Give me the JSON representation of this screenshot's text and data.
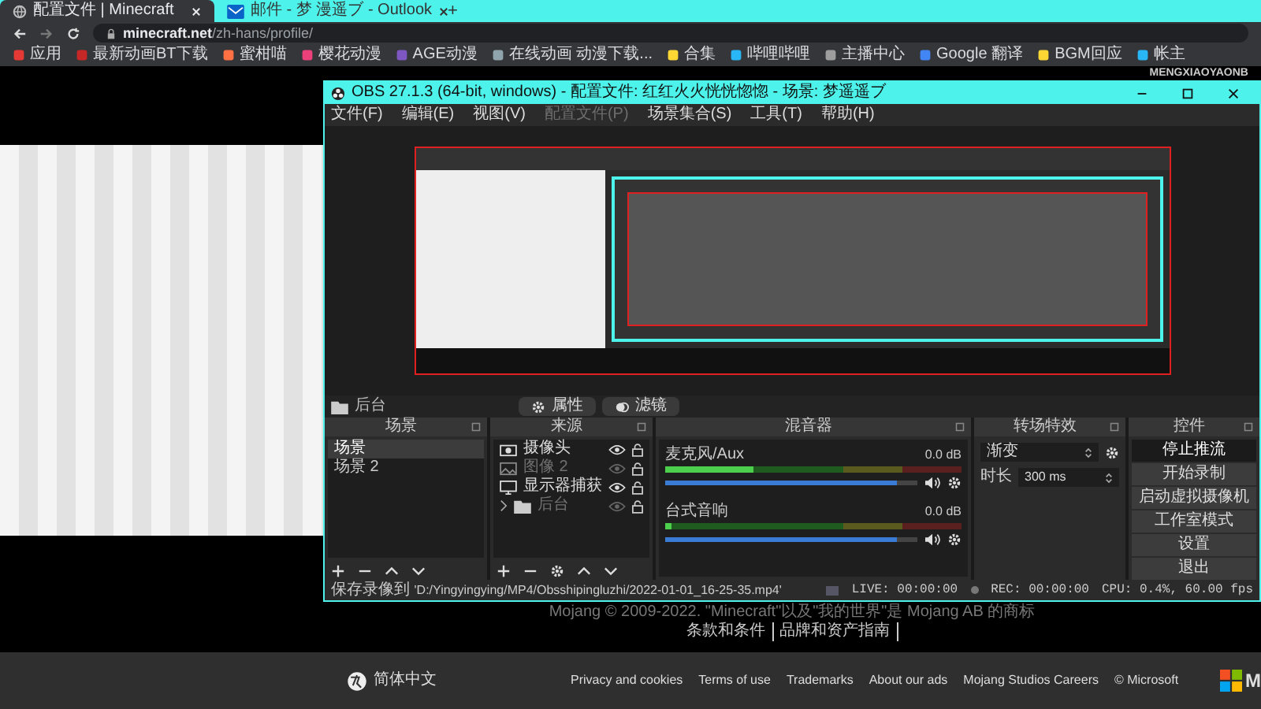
{
  "browser": {
    "tabs": [
      {
        "title": "配置文件 | Minecraft",
        "selected": true
      },
      {
        "title": "邮件 - 梦 漫遥ブ - Outlook",
        "selected": false
      }
    ],
    "new_tab": "+",
    "url": {
      "host": "minecraft.net",
      "path": "/zh-hans/profile/"
    },
    "bookmarks": [
      "应用",
      "最新动画BT下载",
      "蜜柑喵",
      "樱花动漫",
      "AGE动漫",
      "在线动画 动漫下载...",
      "合集",
      "哔哩哔哩",
      "主播中心",
      "Google 翻译",
      "BGM回应",
      "帐主"
    ],
    "account": "MENGXIAOYAONB"
  },
  "obs": {
    "title": "OBS 27.1.3 (64-bit, windows) - 配置文件: 红红火火恍恍惚惚 - 场景: 梦遥遥ブ",
    "menu": [
      {
        "label": "文件(F)",
        "disabled": false
      },
      {
        "label": "编辑(E)",
        "disabled": false
      },
      {
        "label": "视图(V)",
        "disabled": false
      },
      {
        "label": "配置文件(P)",
        "disabled": true
      },
      {
        "label": "场景集合(S)",
        "disabled": false
      },
      {
        "label": "工具(T)",
        "disabled": false
      },
      {
        "label": "帮助(H)",
        "disabled": false
      }
    ],
    "active_source": "后台",
    "source_buttons": [
      "属性",
      "滤镜"
    ],
    "scenes": {
      "title": "场景",
      "items": [
        {
          "name": "场景",
          "selected": true
        },
        {
          "name": "场景 2",
          "selected": false
        }
      ]
    },
    "sources": {
      "title": "来源",
      "items": [
        {
          "name": "摄像头",
          "kind": "camera",
          "visible": true
        },
        {
          "name": "图像 2",
          "kind": "image",
          "visible": false
        },
        {
          "name": "显示器捕获",
          "kind": "monitor",
          "visible": true
        },
        {
          "name": "后台",
          "kind": "folder",
          "visible": false
        }
      ]
    },
    "mixer": {
      "title": "混音器",
      "channels": [
        {
          "name": "麦克风/Aux",
          "reading": "0.0 dB",
          "meter": {
            "level": 0.3
          },
          "fader": {
            "level": 0.92
          }
        },
        {
          "name": "台式音响",
          "reading": "0.0 dB",
          "meter": {
            "level": 0.02
          },
          "fader": {
            "level": 0.92
          }
        }
      ]
    },
    "transitions": {
      "title": "转场特效",
      "type": "渐变",
      "duration_label": "时长",
      "duration": "300 ms"
    },
    "controls": {
      "title": "控件",
      "buttons": [
        {
          "label": "停止推流",
          "active": true
        },
        {
          "label": "开始录制",
          "active": false
        },
        {
          "label": "启动虚拟摄像机",
          "active": false
        },
        {
          "label": "工作室模式",
          "active": false
        },
        {
          "label": "设置",
          "active": false
        },
        {
          "label": "退出",
          "active": false
        }
      ]
    },
    "status": {
      "path_label": "保存录像到",
      "path": "'D:/Yingyingying/MP4/Obsshipingluzhi/2022-01-01_16-25-35.mp4'",
      "live": "LIVE: 00:00:00",
      "rec": "REC: 00:00:00",
      "cpu": "CPU: 0.4%, 60.00 fps"
    }
  },
  "page": {
    "copyright": "Mojang © 2009-2022. \"Minecraft\"以及\"我的世界\"是 Mojang AB 的商标",
    "links": [
      "条款和条件",
      "品牌和资产指南"
    ]
  },
  "footer": {
    "language": "简体中文",
    "links": [
      "Privacy and cookies",
      "Terms of use",
      "Trademarks",
      "About our ads",
      "Mojang Studios Careers",
      "© Microsoft"
    ],
    "brand": "M"
  }
}
